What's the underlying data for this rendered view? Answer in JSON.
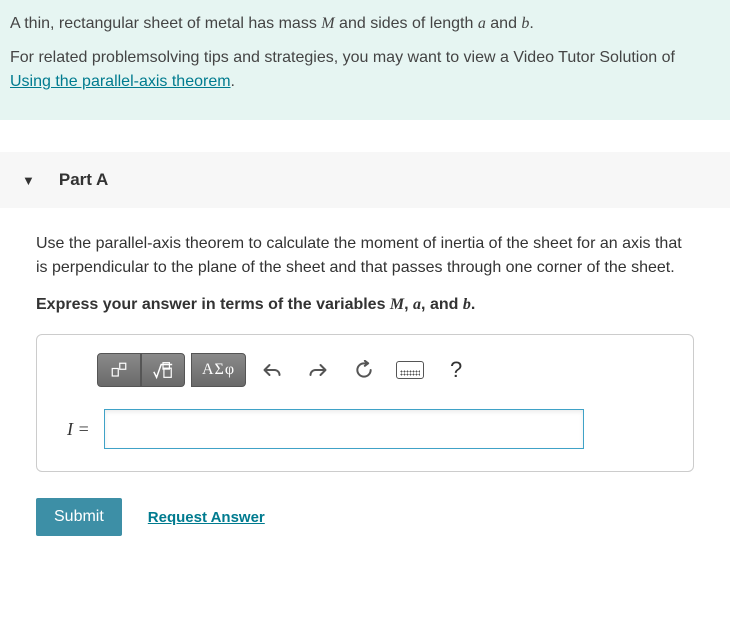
{
  "intro": {
    "problem_text_pre": "A thin, rectangular sheet of metal has mass ",
    "var_M": "M",
    "problem_text_mid": " and sides of length ",
    "var_a": "a",
    "problem_text_and": " and ",
    "var_b": "b",
    "problem_text_end": ".",
    "tips_text_pre": "For related problemsolving tips and strategies, you may want to view a Video Tutor Solution of ",
    "tips_link": "Using the parallel-axis theorem",
    "tips_text_end": "."
  },
  "part": {
    "label": "Part A",
    "question": "Use the parallel-axis theorem to calculate the moment of inertia of the sheet for an axis that is perpendicular to the plane of the sheet and that passes through one corner of the sheet.",
    "express_pre": "Express your answer in terms of the variables ",
    "express_M": "M",
    "express_sep1": ", ",
    "express_a": "a",
    "express_sep2": ", and ",
    "express_b": "b",
    "express_end": "."
  },
  "toolbar": {
    "template_label": "▫",
    "math_label": "√",
    "greek_label": "ΑΣφ",
    "help_label": "?"
  },
  "answer": {
    "lhs": "I =",
    "value": ""
  },
  "actions": {
    "submit": "Submit",
    "request": "Request Answer"
  }
}
